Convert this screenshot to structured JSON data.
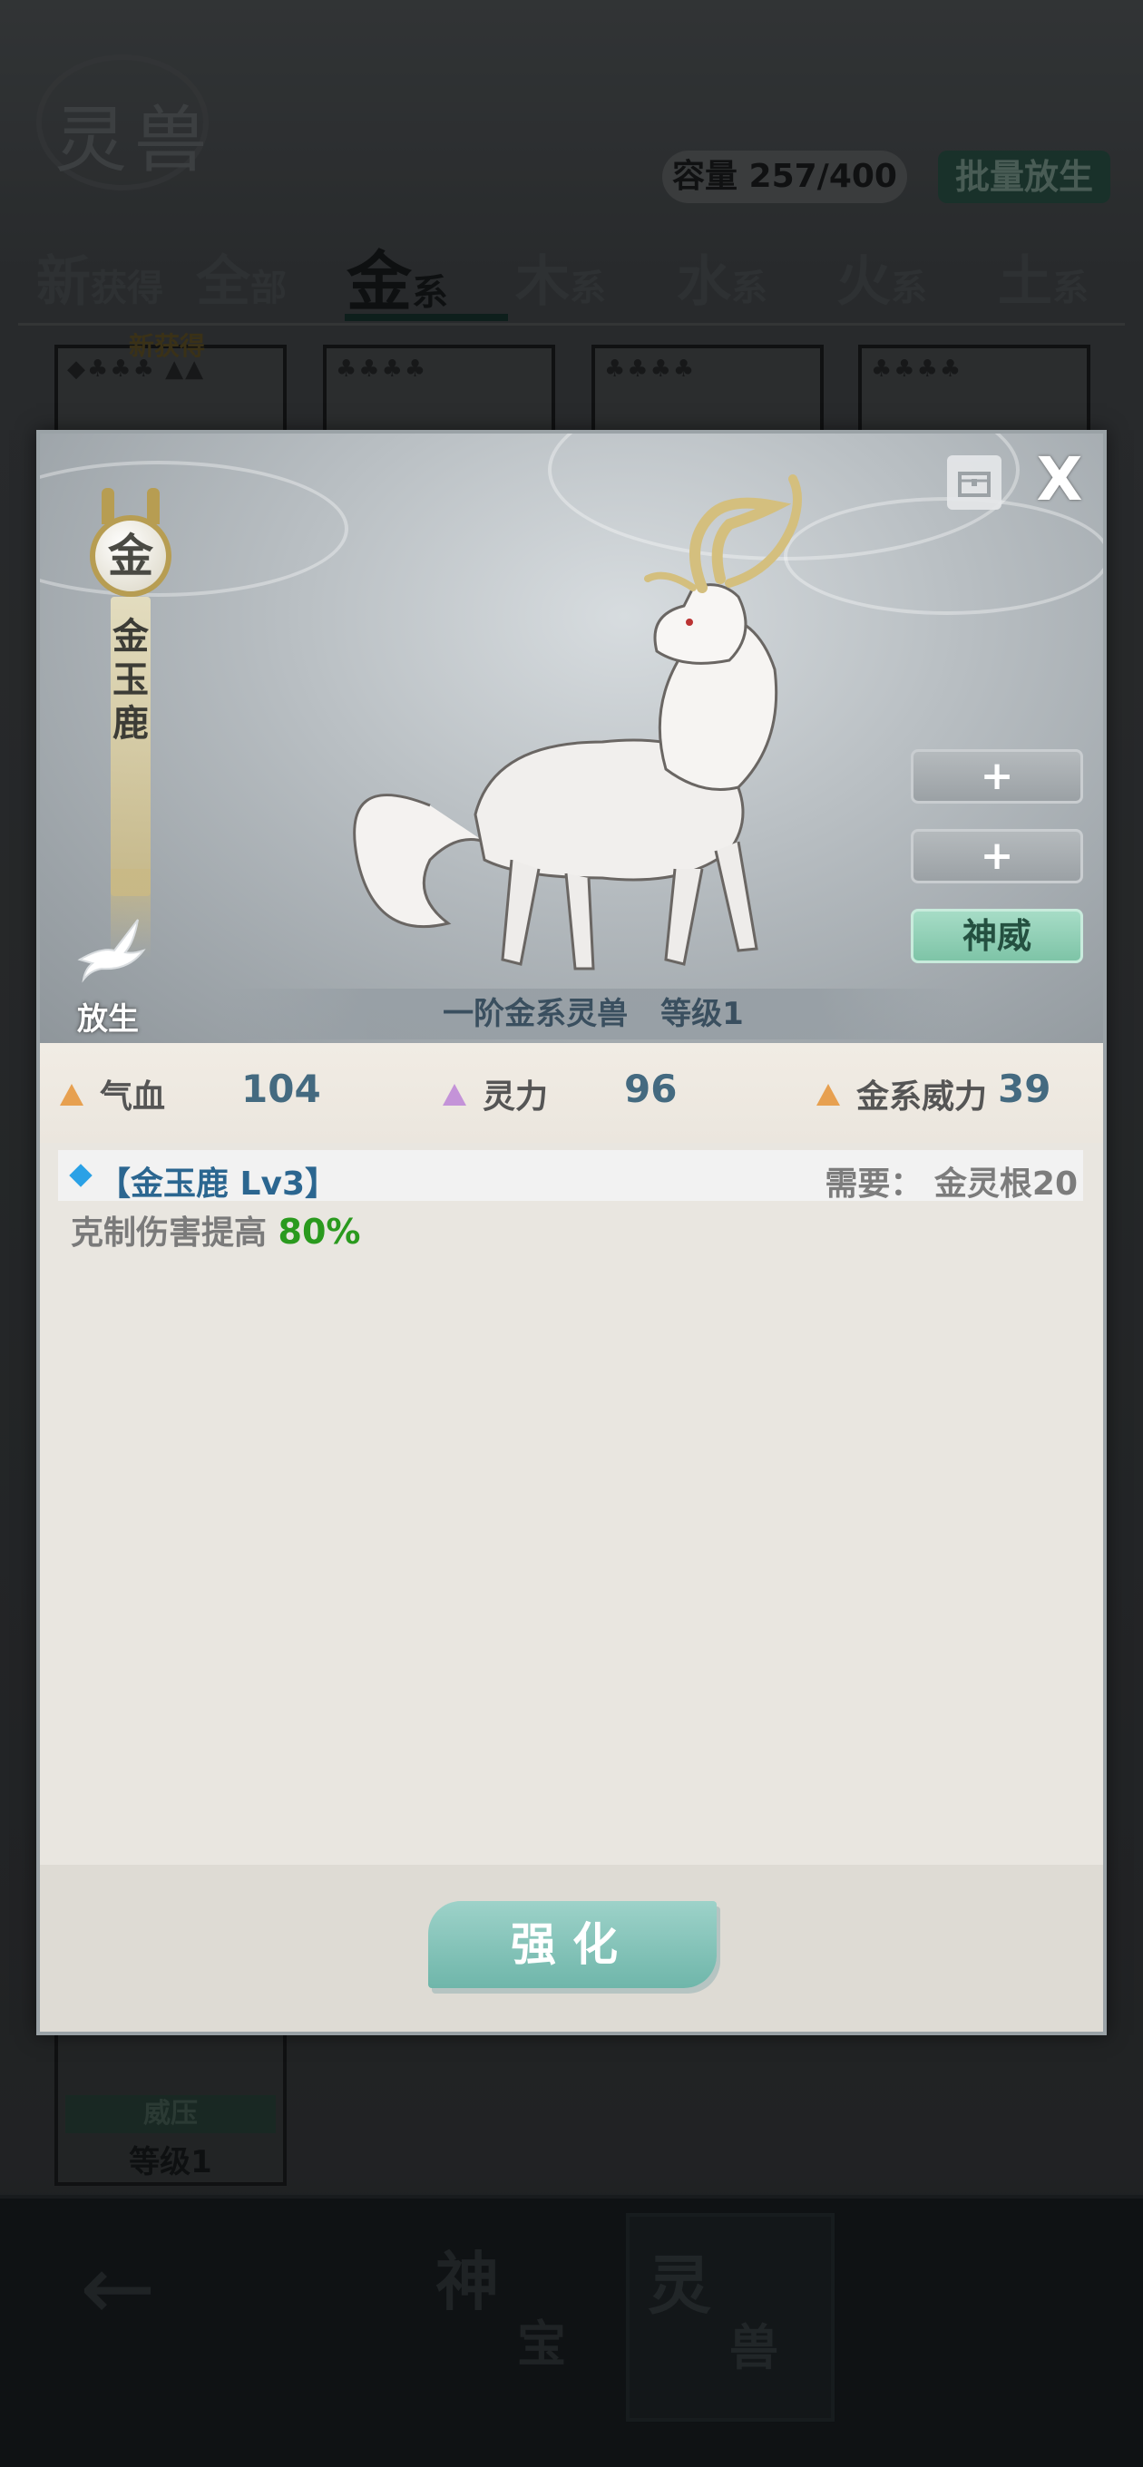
{
  "background": {
    "logo_text": "灵兽",
    "capacity_label": "容量 257/400",
    "batch_release_label": "批量放生",
    "tabs": [
      {
        "big": "新",
        "small": "获得"
      },
      {
        "big": "全",
        "small": "部"
      },
      {
        "big": "金",
        "small": "系"
      },
      {
        "big": "木",
        "small": "系"
      },
      {
        "big": "水",
        "small": "系"
      },
      {
        "big": "火",
        "small": "系"
      },
      {
        "big": "土",
        "small": "系"
      }
    ],
    "new_label": "新获得",
    "bottom_card": {
      "tag": "威压",
      "level": "等级1"
    },
    "nav": {
      "back": "←",
      "tab1": {
        "big": "神",
        "small": "宝"
      },
      "tab2": {
        "big": "灵",
        "small": "兽"
      }
    }
  },
  "modal": {
    "element": "金",
    "beast_name": "金玉鹿",
    "release_label": "放生",
    "close_label": "X",
    "side_buttons": [
      "+",
      "+",
      "神威"
    ],
    "caption_rank": "一阶金系灵兽",
    "caption_level": "等级1",
    "stats": [
      {
        "label": "气血",
        "value": "104",
        "color": "#e7a050"
      },
      {
        "label": "灵力",
        "value": "96",
        "color": "#c493d8"
      },
      {
        "label": "金系威力",
        "value": "39",
        "color": "#e7a050"
      }
    ],
    "skill": {
      "name": "【金玉鹿 Lv3】",
      "requirement": "需要： 金灵根20",
      "desc_prefix": "克制伤害提高 ",
      "desc_value": "80%"
    },
    "enhance_label": "强化"
  }
}
